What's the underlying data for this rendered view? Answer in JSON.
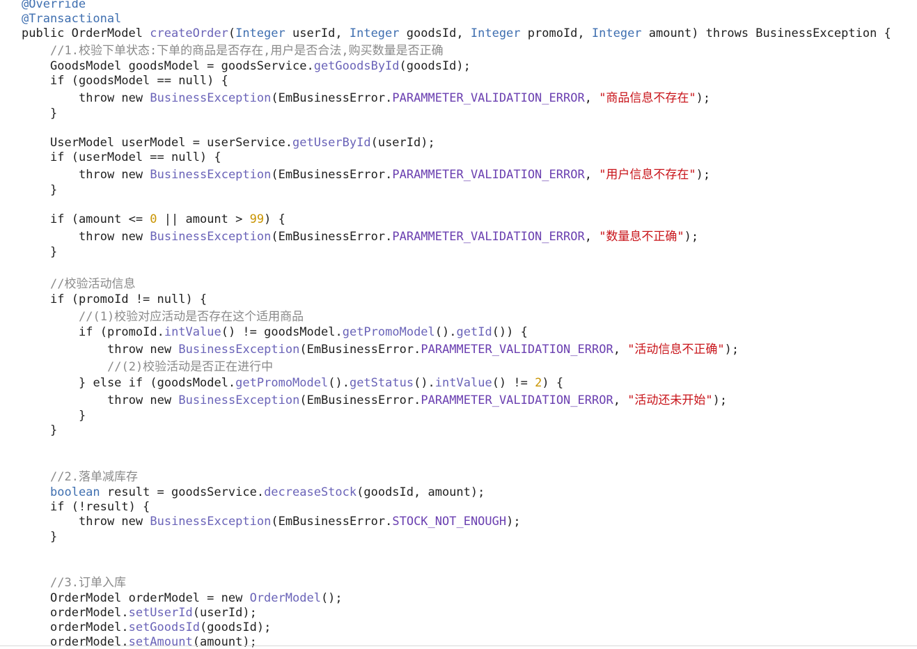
{
  "editor": {
    "lines": [
      {
        "indent": 0,
        "tokens": [
          {
            "k": "ann",
            "t": "@Override"
          }
        ]
      },
      {
        "indent": 0,
        "tokens": [
          {
            "k": "ann",
            "t": "@Transactional"
          }
        ]
      },
      {
        "indent": 0,
        "tokens": [
          {
            "k": "plain",
            "t": "public OrderModel "
          },
          {
            "k": "method",
            "t": "createOrder"
          },
          {
            "k": "plain",
            "t": "("
          },
          {
            "k": "type",
            "t": "Integer"
          },
          {
            "k": "plain",
            "t": " userId, "
          },
          {
            "k": "type",
            "t": "Integer"
          },
          {
            "k": "plain",
            "t": " goodsId, "
          },
          {
            "k": "type",
            "t": "Integer"
          },
          {
            "k": "plain",
            "t": " promoId, "
          },
          {
            "k": "type",
            "t": "Integer"
          },
          {
            "k": "plain",
            "t": " amount) throws BusinessException {"
          }
        ]
      },
      {
        "indent": 1,
        "tokens": [
          {
            "k": "comment",
            "t": "//1.校验下单状态:下单的商品是否存在,用户是否合法,购买数量是否正确"
          }
        ]
      },
      {
        "indent": 1,
        "tokens": [
          {
            "k": "plain",
            "t": "GoodsModel goodsModel = goodsService."
          },
          {
            "k": "method",
            "t": "getGoodsById"
          },
          {
            "k": "plain",
            "t": "(goodsId);"
          }
        ]
      },
      {
        "indent": 1,
        "tokens": [
          {
            "k": "plain",
            "t": "if (goodsModel == null) {"
          }
        ]
      },
      {
        "indent": 2,
        "tokens": [
          {
            "k": "plain",
            "t": "throw new "
          },
          {
            "k": "method",
            "t": "BusinessException"
          },
          {
            "k": "plain",
            "t": "(EmBusinessError."
          },
          {
            "k": "field",
            "t": "PARAMMETER_VALIDATION_ERROR"
          },
          {
            "k": "plain",
            "t": ", "
          },
          {
            "k": "string",
            "t": "\"商品信息不存在\""
          },
          {
            "k": "plain",
            "t": ");"
          }
        ]
      },
      {
        "indent": 1,
        "tokens": [
          {
            "k": "plain",
            "t": "}"
          }
        ]
      },
      {
        "indent": 1,
        "tokens": [
          {
            "k": "plain",
            "t": "UserModel userModel = userService."
          },
          {
            "k": "method",
            "t": "getUserById"
          },
          {
            "k": "plain",
            "t": "(userId);"
          }
        ]
      },
      {
        "indent": 1,
        "tokens": [
          {
            "k": "plain",
            "t": "if (userModel == null) {"
          }
        ]
      },
      {
        "indent": 2,
        "tokens": [
          {
            "k": "plain",
            "t": "throw new "
          },
          {
            "k": "method",
            "t": "BusinessException"
          },
          {
            "k": "plain",
            "t": "(EmBusinessError."
          },
          {
            "k": "field",
            "t": "PARAMMETER_VALIDATION_ERROR"
          },
          {
            "k": "plain",
            "t": ", "
          },
          {
            "k": "string",
            "t": "\"用户信息不存在\""
          },
          {
            "k": "plain",
            "t": ");"
          }
        ]
      },
      {
        "indent": 1,
        "tokens": [
          {
            "k": "plain",
            "t": "}"
          }
        ]
      },
      {
        "indent": 1,
        "tokens": [
          {
            "k": "plain",
            "t": "if (amount <= "
          },
          {
            "k": "number",
            "t": "0"
          },
          {
            "k": "plain",
            "t": " || amount > "
          },
          {
            "k": "number",
            "t": "99"
          },
          {
            "k": "plain",
            "t": ") {"
          }
        ]
      },
      {
        "indent": 2,
        "tokens": [
          {
            "k": "plain",
            "t": "throw new "
          },
          {
            "k": "method",
            "t": "BusinessException"
          },
          {
            "k": "plain",
            "t": "(EmBusinessError."
          },
          {
            "k": "field",
            "t": "PARAMMETER_VALIDATION_ERROR"
          },
          {
            "k": "plain",
            "t": ", "
          },
          {
            "k": "string",
            "t": "\"数量息不正确\""
          },
          {
            "k": "plain",
            "t": ");"
          }
        ]
      },
      {
        "indent": 1,
        "tokens": [
          {
            "k": "plain",
            "t": "}"
          }
        ]
      },
      {
        "indent": 1,
        "tokens": [
          {
            "k": "comment",
            "t": "//校验活动信息"
          }
        ]
      },
      {
        "indent": 1,
        "tokens": [
          {
            "k": "plain",
            "t": "if (promoId != null) {"
          }
        ]
      },
      {
        "indent": 2,
        "tokens": [
          {
            "k": "comment",
            "t": "//(1)校验对应活动是否存在这个适用商品"
          }
        ]
      },
      {
        "indent": 2,
        "tokens": [
          {
            "k": "plain",
            "t": "if (promoId."
          },
          {
            "k": "method",
            "t": "intValue"
          },
          {
            "k": "plain",
            "t": "() != goodsModel."
          },
          {
            "k": "method",
            "t": "getPromoModel"
          },
          {
            "k": "plain",
            "t": "()."
          },
          {
            "k": "method",
            "t": "getId"
          },
          {
            "k": "plain",
            "t": "()) {"
          }
        ]
      },
      {
        "indent": 3,
        "tokens": [
          {
            "k": "plain",
            "t": "throw new "
          },
          {
            "k": "method",
            "t": "BusinessException"
          },
          {
            "k": "plain",
            "t": "(EmBusinessError."
          },
          {
            "k": "field",
            "t": "PARAMMETER_VALIDATION_ERROR"
          },
          {
            "k": "plain",
            "t": ", "
          },
          {
            "k": "string",
            "t": "\"活动信息不正确\""
          },
          {
            "k": "plain",
            "t": ");"
          }
        ]
      },
      {
        "indent": 3,
        "tokens": [
          {
            "k": "comment",
            "t": "//(2)校验活动是否正在进行中"
          }
        ]
      },
      {
        "indent": 2,
        "tokens": [
          {
            "k": "plain",
            "t": "} else if (goodsModel."
          },
          {
            "k": "method",
            "t": "getPromoModel"
          },
          {
            "k": "plain",
            "t": "()."
          },
          {
            "k": "method",
            "t": "getStatus"
          },
          {
            "k": "plain",
            "t": "()."
          },
          {
            "k": "method",
            "t": "intValue"
          },
          {
            "k": "plain",
            "t": "() != "
          },
          {
            "k": "number",
            "t": "2"
          },
          {
            "k": "plain",
            "t": ") {"
          }
        ]
      },
      {
        "indent": 3,
        "tokens": [
          {
            "k": "plain",
            "t": "throw new "
          },
          {
            "k": "method",
            "t": "BusinessException"
          },
          {
            "k": "plain",
            "t": "(EmBusinessError."
          },
          {
            "k": "field",
            "t": "PARAMMETER_VALIDATION_ERROR"
          },
          {
            "k": "plain",
            "t": ", "
          },
          {
            "k": "string",
            "t": "\"活动还未开始\""
          },
          {
            "k": "plain",
            "t": ");"
          }
        ]
      },
      {
        "indent": 2,
        "tokens": [
          {
            "k": "plain",
            "t": "}"
          }
        ]
      },
      {
        "indent": 1,
        "tokens": [
          {
            "k": "plain",
            "t": "}"
          }
        ]
      },
      {
        "indent": 1,
        "tokens": [
          {
            "k": "comment",
            "t": "//2.落单减库存"
          }
        ]
      },
      {
        "indent": 1,
        "tokens": [
          {
            "k": "type",
            "t": "boolean"
          },
          {
            "k": "plain",
            "t": " result = goodsService."
          },
          {
            "k": "method",
            "t": "decreaseStock"
          },
          {
            "k": "plain",
            "t": "(goodsId, amount);"
          }
        ]
      },
      {
        "indent": 1,
        "tokens": [
          {
            "k": "plain",
            "t": "if (!result) {"
          }
        ]
      },
      {
        "indent": 2,
        "tokens": [
          {
            "k": "plain",
            "t": "throw new "
          },
          {
            "k": "method",
            "t": "BusinessException"
          },
          {
            "k": "plain",
            "t": "(EmBusinessError."
          },
          {
            "k": "field",
            "t": "STOCK_NOT_ENOUGH"
          },
          {
            "k": "plain",
            "t": ");"
          }
        ]
      },
      {
        "indent": 1,
        "tokens": [
          {
            "k": "plain",
            "t": "}"
          }
        ]
      },
      {
        "indent": 1,
        "tokens": [
          {
            "k": "comment",
            "t": "//3.订单入库"
          }
        ]
      },
      {
        "indent": 1,
        "tokens": [
          {
            "k": "plain",
            "t": "OrderModel orderModel = new "
          },
          {
            "k": "method",
            "t": "OrderModel"
          },
          {
            "k": "plain",
            "t": "();"
          }
        ]
      },
      {
        "indent": 1,
        "tokens": [
          {
            "k": "plain",
            "t": "orderModel."
          },
          {
            "k": "method",
            "t": "setUserId"
          },
          {
            "k": "plain",
            "t": "(userId);"
          }
        ]
      },
      {
        "indent": 1,
        "tokens": [
          {
            "k": "plain",
            "t": "orderModel."
          },
          {
            "k": "method",
            "t": "setGoodsId"
          },
          {
            "k": "plain",
            "t": "(goodsId);"
          }
        ]
      },
      {
        "indent": 1,
        "tokens": [
          {
            "k": "plain",
            "t": "orderModel."
          },
          {
            "k": "method",
            "t": "setAmount"
          },
          {
            "k": "plain",
            "t": "(amount);"
          }
        ]
      }
    ]
  }
}
